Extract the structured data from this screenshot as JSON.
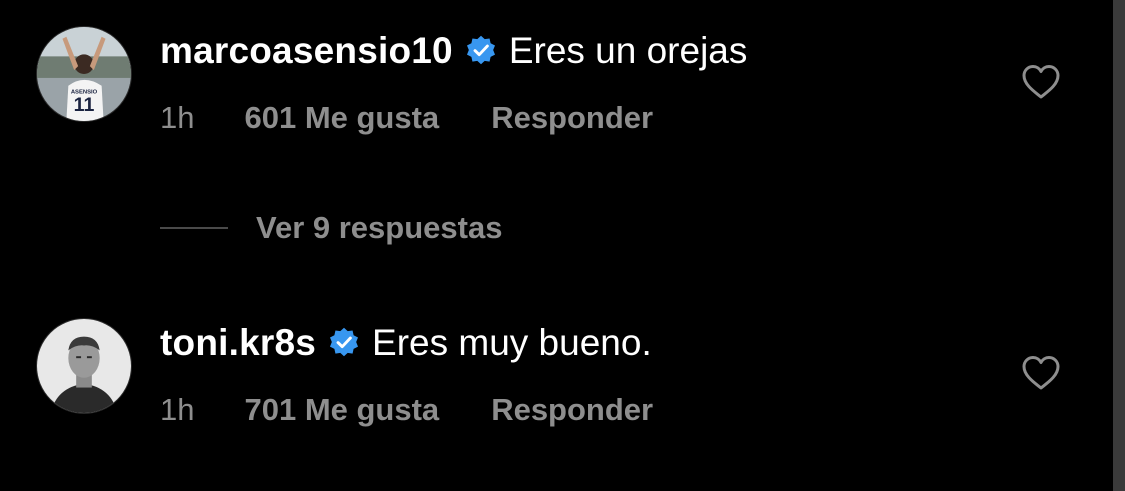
{
  "colors": {
    "background": "#000000",
    "primary_text": "#ffffff",
    "secondary_text": "#8e8e8e",
    "verified_badge": "#3897f0"
  },
  "comments": [
    {
      "username": "marcoasensio10",
      "verified_icon": "verified-badge-icon",
      "text": "Eres un orejas",
      "time": "1h",
      "likes": "601 Me gusta",
      "reply_label": "Responder",
      "like_icon": "heart-outline-icon"
    },
    {
      "username": "toni.kr8s",
      "verified_icon": "verified-badge-icon",
      "text": "Eres muy bueno.",
      "time": "1h",
      "likes": "701 Me gusta",
      "reply_label": "Responder",
      "like_icon": "heart-outline-icon"
    }
  ],
  "view_replies": {
    "label": "Ver 9 respuestas"
  }
}
